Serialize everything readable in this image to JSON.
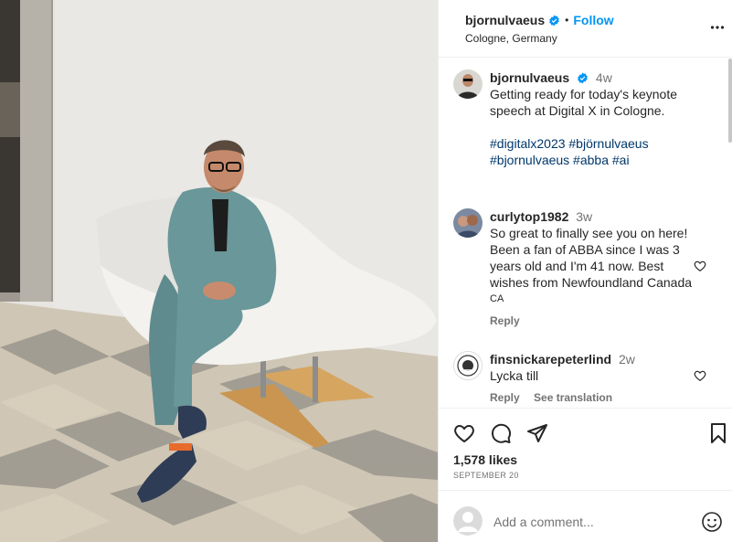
{
  "post": {
    "author": "bjornulvaeus",
    "follow_label": "Follow",
    "location": "Cologne, Germany",
    "dot": "•"
  },
  "caption": {
    "username": "bjornulvaeus",
    "time": "4w",
    "text": "Getting ready for today's keynote speech at Digital X in Cologne.",
    "hashtags_line1": "#digitalx2023 #björnulvaeus",
    "hashtags_line2": "#bjornulvaeus #abba #ai"
  },
  "comments": [
    {
      "username": "curlytop1982",
      "time": "3w",
      "text": "So great to finally see you on here! Been a fan of ABBA since I was 3 years old and I'm 41 now. Best wishes from Newfoundland Canada",
      "flag": "CA",
      "reply_label": "Reply"
    },
    {
      "username": "finsnickarepeterlind",
      "time": "2w",
      "text": "Lycka till",
      "reply_label": "Reply",
      "translate_label": "See translation"
    }
  ],
  "likes": "1,578 likes",
  "date": "SEPTEMBER 20",
  "add_comment": {
    "placeholder": "Add a comment..."
  },
  "icons": {
    "verified": "verified-badge-icon",
    "more": "more-options-icon",
    "like": "heart-icon",
    "comment": "comment-icon",
    "share": "share-icon",
    "save": "bookmark-icon",
    "emoji": "emoji-icon"
  },
  "colors": {
    "accent": "#0095f6",
    "verified": "#0095f6",
    "hashtag": "#00376b",
    "secondary_text": "#737373"
  }
}
